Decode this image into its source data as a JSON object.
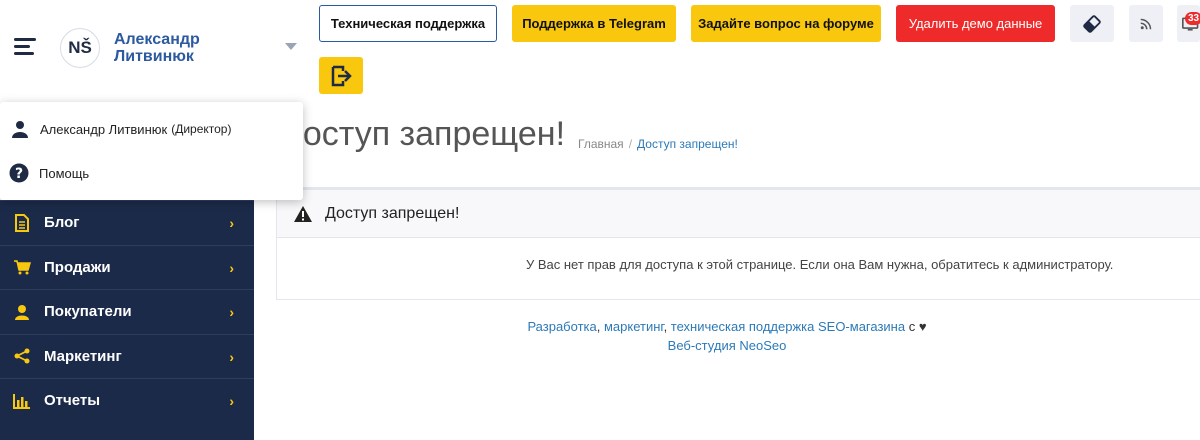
{
  "brand": {
    "logo_text": "NŠ",
    "name_line1": "Александр",
    "name_line2": "Литвинюк"
  },
  "topbar": {
    "support_label": "Техническая поддержка",
    "telegram_label": "Поддержка в Telegram",
    "forum_label": "Задайте вопрос на форуме",
    "delete_demo_label": "Удалить демо данные",
    "notification_count": "33",
    "icons": [
      "eraser-icon",
      "rss-icon",
      "notification-icon",
      "logout-icon"
    ]
  },
  "user_menu": {
    "user_name": "Александр Литвинюк",
    "user_role": "(Директор)",
    "help_label": "Помощь"
  },
  "sidebar": {
    "items": [
      {
        "label": "Блог",
        "icon": "document-icon"
      },
      {
        "label": "Продажи",
        "icon": "cart-icon"
      },
      {
        "label": "Покупатели",
        "icon": "user-icon"
      },
      {
        "label": "Маркетинг",
        "icon": "share-icon"
      },
      {
        "label": "Отчеты",
        "icon": "bar-chart-icon"
      }
    ],
    "chevron": "›"
  },
  "page": {
    "title": "доступ запрещен!",
    "breadcrumb_home": "Главная",
    "breadcrumb_sep": "/",
    "breadcrumb_current": "Доступ запрещен!"
  },
  "panel": {
    "title": "Доступ запрещен!",
    "message": "У Вас нет прав для доступа к этой странице. Если она Вам нужна, обратитесь к администратору."
  },
  "footer": {
    "link1": "Разработка",
    "sep1": ", ",
    "link2": "маркетинг",
    "sep2": ", ",
    "link3": "техническая поддержка SEO-магазина",
    "suffix": " с ",
    "heart": "♥",
    "link4": "Веб-студия NeoSeo"
  },
  "colors": {
    "accent_yellow": "#f9c80e",
    "danger_red": "#ee2a2a",
    "sidebar_bg": "#1c2a4a",
    "link_blue": "#2c7ab8"
  }
}
